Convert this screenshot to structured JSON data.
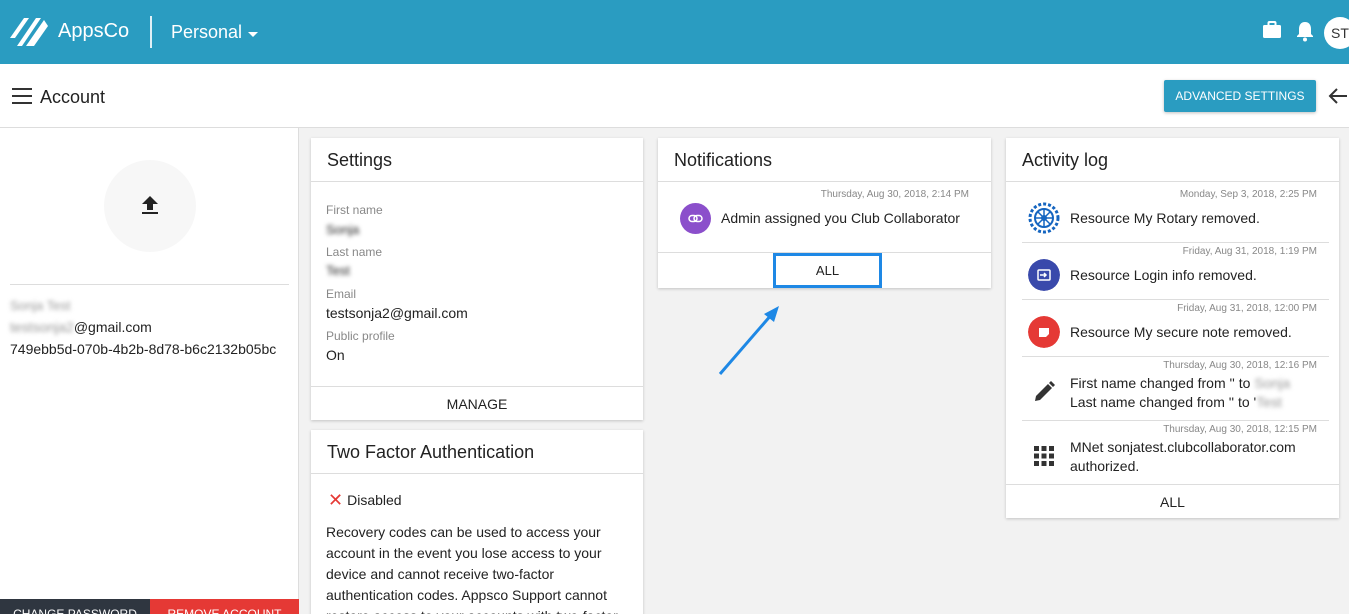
{
  "app": {
    "brand": "AppsCo",
    "workspace": "Personal",
    "avatar_initials": "ST",
    "accent": "#2a9cc1"
  },
  "subheader": {
    "title": "Account",
    "advanced_settings": "ADVANCED SETTINGS"
  },
  "profile": {
    "name": "Sonja Test",
    "email_prefix": "testsonja2",
    "email_domain": "@gmail.com",
    "id": "749ebb5d-070b-4b2b-8d78-b6c2132b05bc",
    "change_password": "CHANGE PASSWORD",
    "remove_account": "REMOVE ACCOUNT"
  },
  "settings": {
    "title": "Settings",
    "first_name_label": "First name",
    "first_name": "Sonja",
    "last_name_label": "Last name",
    "last_name": "Test",
    "email_label": "Email",
    "email": "testsonja2@gmail.com",
    "public_profile_label": "Public profile",
    "public_profile": "On",
    "manage": "MANAGE"
  },
  "tfa": {
    "title": "Two Factor Authentication",
    "status": "Disabled",
    "description": "Recovery codes can be used to access your account in the event you lose access to your device and cannot receive two-factor authentication codes. Appsco Support cannot restore access to your accounts with two-factor"
  },
  "notifications": {
    "title": "Notifications",
    "items": [
      {
        "time": "Thursday, Aug 30, 2018, 2:14 PM",
        "text": "Admin assigned you Club Collaborator",
        "icon": "link-icon"
      }
    ],
    "all": "ALL"
  },
  "activity": {
    "title": "Activity log",
    "items": [
      {
        "time": "Monday, Sep 3, 2018, 2:25 PM",
        "text": "Resource My Rotary removed.",
        "icon": "rotary-icon"
      },
      {
        "time": "Friday, Aug 31, 2018, 1:19 PM",
        "text": "Resource Login info removed.",
        "icon": "login-icon",
        "color": "#3949ab"
      },
      {
        "time": "Friday, Aug 31, 2018, 12:00 PM",
        "text": "Resource My secure note removed.",
        "icon": "note-icon",
        "color": "#e53935"
      },
      {
        "time": "Thursday, Aug 30, 2018, 12:16 PM",
        "line1": "First name changed from '' to ",
        "line1_blur": "Sonja",
        "line2": "Last name changed from '' to '",
        "line2_blur": "Test",
        "icon": "pencil-icon"
      },
      {
        "time": "Thursday, Aug 30, 2018, 12:15 PM",
        "line1": "MNet sonjatest.clubcollaborator.com",
        "line2": "authorized.",
        "icon": "apps-grid-icon"
      }
    ],
    "all": "ALL"
  }
}
